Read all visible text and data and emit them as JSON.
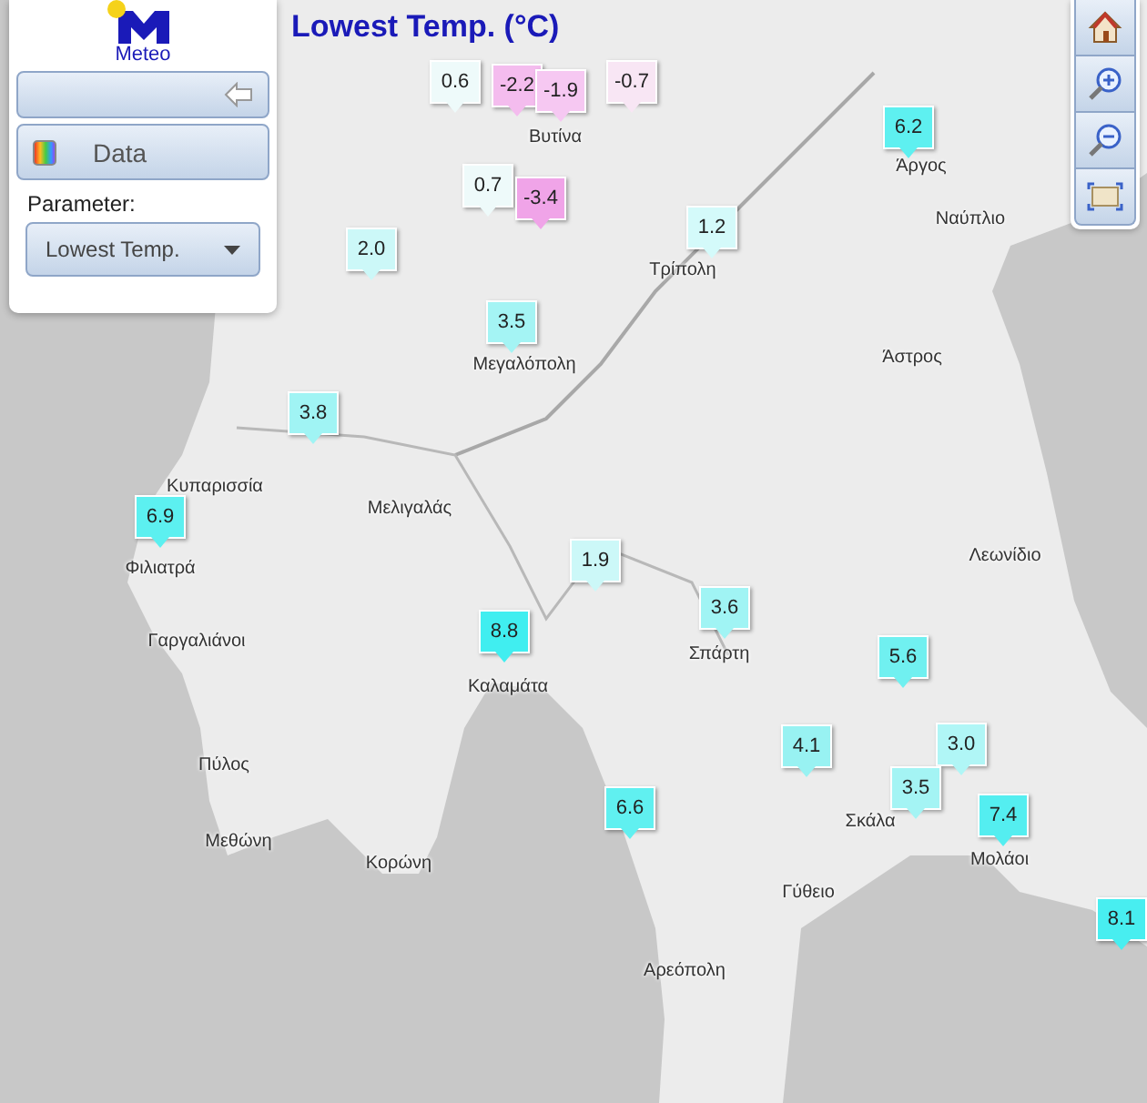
{
  "logo": {
    "text": "Meteo"
  },
  "panel": {
    "data_button": "Data",
    "parameter_label": "Parameter:",
    "parameter_value": "Lowest Temp."
  },
  "map_title": "Lowest Temp. (°C)",
  "places": [
    "Βυτίνα",
    "Άργος",
    "Ναύπλιο",
    "Τρίπολη",
    "Μεγαλόπολη",
    "Άστρος",
    "Κυπαρισσία",
    "Μελιγαλάς",
    "Φιλιατρά",
    "Λεωνίδιο",
    "Γαργαλιάνοι",
    "Καλαμάτα",
    "Σπάρτη",
    "Πύλος",
    "Μεθώνη",
    "Κορώνη",
    "Σκάλα",
    "Μολάοι",
    "Γύθειο",
    "Αρεόπολη"
  ],
  "markers": [
    {
      "value": "0.6",
      "color": "#eefafa"
    },
    {
      "value": "-2.2",
      "color": "#f4bcee"
    },
    {
      "value": "-1.9",
      "color": "#f6c8f2"
    },
    {
      "value": "-0.7",
      "color": "#f8e6f4"
    },
    {
      "value": "6.2",
      "color": "#5ef0f0"
    },
    {
      "value": "0.7",
      "color": "#eefafa"
    },
    {
      "value": "-3.4",
      "color": "#f0a4e8"
    },
    {
      "value": "1.2",
      "color": "#d4fafa"
    },
    {
      "value": "2.0",
      "color": "#ccf8f8"
    },
    {
      "value": "3.5",
      "color": "#a4f4f4"
    },
    {
      "value": "3.8",
      "color": "#a0f4f4"
    },
    {
      "value": "6.9",
      "color": "#5cf0f0"
    },
    {
      "value": "1.9",
      "color": "#ccf8f8"
    },
    {
      "value": "3.6",
      "color": "#a0f4f4"
    },
    {
      "value": "8.8",
      "color": "#40eef0"
    },
    {
      "value": "5.6",
      "color": "#70f0f0"
    },
    {
      "value": "4.1",
      "color": "#98f2f2"
    },
    {
      "value": "3.0",
      "color": "#b0f6f6"
    },
    {
      "value": "3.5",
      "color": "#a4f4f4"
    },
    {
      "value": "6.6",
      "color": "#60f0f0"
    },
    {
      "value": "7.4",
      "color": "#54eef0"
    },
    {
      "value": "8.1",
      "color": "#48eef0"
    }
  ]
}
